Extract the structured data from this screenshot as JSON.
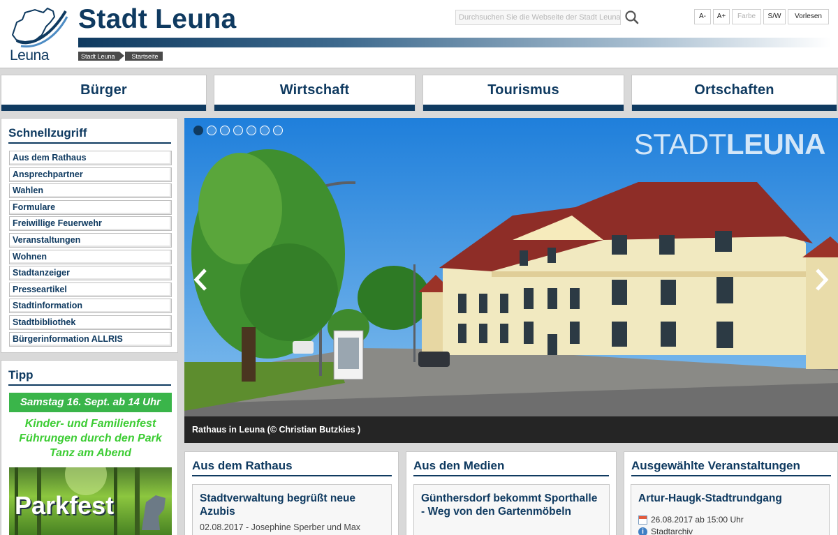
{
  "header": {
    "logo_text": "Leuna",
    "site_title": "Stadt Leuna",
    "breadcrumb": [
      "Stadt Leuna",
      "Startseite"
    ],
    "search_placeholder": "Durchsuchen Sie die Webseite der Stadt Leuna",
    "toolbar": {
      "font_decrease": "A-",
      "font_increase": "A+",
      "color": "Farbe",
      "black_white": "S/W",
      "read_aloud": "Vorlesen"
    }
  },
  "nav": [
    "Bürger",
    "Wirtschaft",
    "Tourismus",
    "Ortschaften"
  ],
  "quick_access": {
    "title": "Schnellzugriff",
    "items": [
      "Aus dem Rathaus",
      "Ansprechpartner",
      "Wahlen",
      "Formulare",
      "Freiwillige Feuerwehr",
      "Veranstaltungen",
      "Wohnen",
      "Stadtanzeiger",
      "Presseartikel",
      "Stadtinformation",
      "Stadtbibliothek",
      "Bürgerinformation ALLRIS"
    ]
  },
  "tip": {
    "title": "Tipp",
    "banner_date": "Samstag 16. Sept. ab 14 Uhr",
    "lines": [
      "Kinder- und Familienfest",
      "Führungen durch den Park",
      "Tanz am Abend"
    ],
    "image_text": "Parkfest"
  },
  "slider": {
    "watermark_light": "STADT",
    "watermark_bold": "LEUNA",
    "caption": "Rathaus in Leuna (© Christian Butzkies )",
    "slide_count": 7,
    "active_index": 0
  },
  "sections": [
    {
      "title": "Aus dem Rathaus",
      "card_title": "Stadtverwaltung begrüßt neue Azubis",
      "card_meta": "02.08.2017 - Josephine Sperber und Max"
    },
    {
      "title": "Aus den Medien",
      "card_title": "Günthersdorf bekommt Sporthalle - Weg von den Gartenmöbeln",
      "card_meta": ""
    },
    {
      "title": "Ausgewählte Veranstaltungen",
      "card_title": "Artur-Haugk-Stadtrundgang",
      "event_date": "26.08.2017 ab 15:00 Uhr",
      "event_org": "Stadtarchiv"
    }
  ],
  "colors": {
    "brand_blue": "#0f3a60",
    "tip_green": "#39b54a",
    "tip_text_green": "#33cc33"
  }
}
